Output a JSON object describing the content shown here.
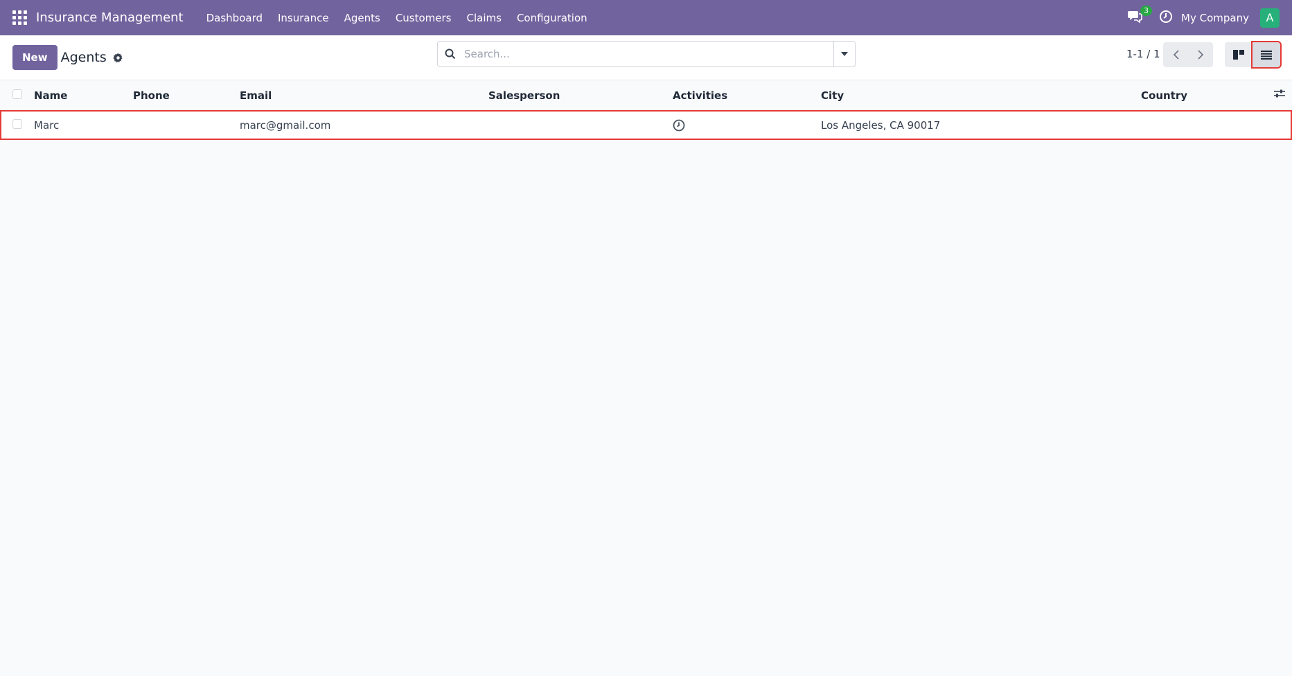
{
  "navbar": {
    "brand": "Insurance Management",
    "menu": [
      "Dashboard",
      "Insurance",
      "Agents",
      "Customers",
      "Claims",
      "Configuration"
    ],
    "chat_count": "3",
    "company": "My Company",
    "avatar_letter": "A",
    "colors": {
      "bar": "#71639e",
      "badge": "#28a745",
      "avatar": "#27b07a"
    }
  },
  "control": {
    "new_label": "New",
    "title": "Agents",
    "search_placeholder": "Search...",
    "pager": "1-1 / 1"
  },
  "table": {
    "columns": [
      "Name",
      "Phone",
      "Email",
      "Salesperson",
      "Activities",
      "City",
      "Country"
    ],
    "rows": [
      {
        "name": "Marc",
        "phone": "",
        "email": "marc@gmail.com",
        "salesperson": "",
        "activity_icon": "clock-icon",
        "city": "Los Angeles, CA 90017",
        "country": ""
      }
    ]
  }
}
